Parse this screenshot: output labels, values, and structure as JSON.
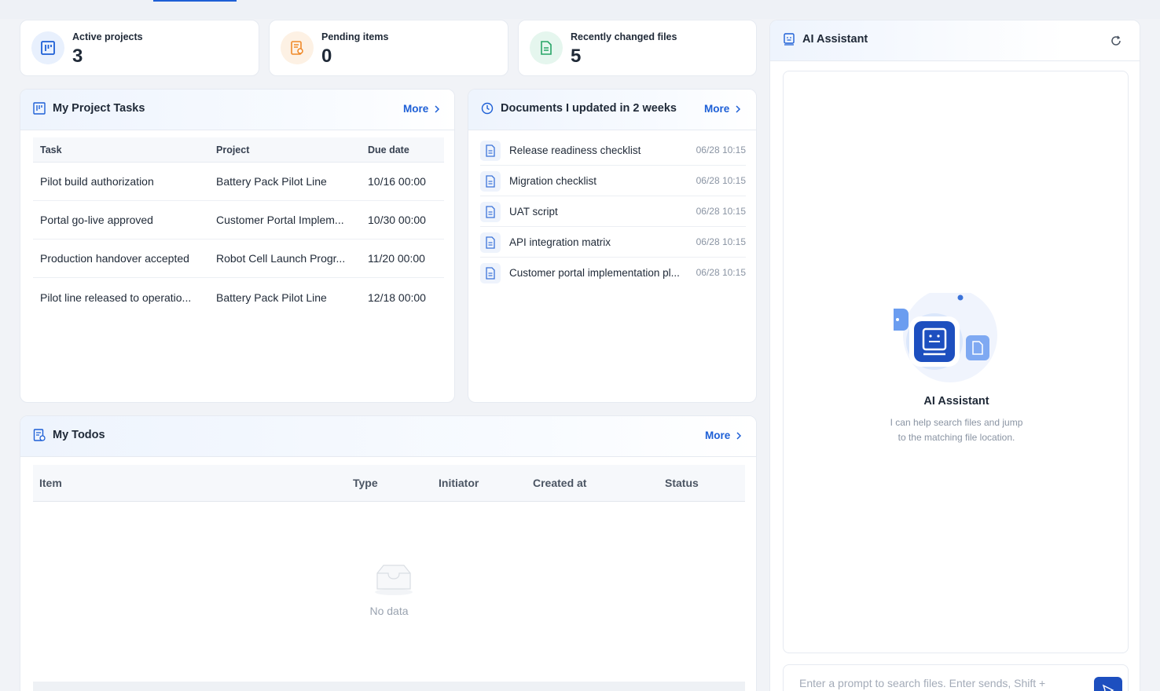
{
  "stats": [
    {
      "label": "Active projects",
      "value": "3",
      "icon": "kanban-icon",
      "bg": "#e8f0fd",
      "color": "#1d5fd6"
    },
    {
      "label": "Pending items",
      "value": "0",
      "icon": "pending-doc-icon",
      "bg": "#fdf1e4",
      "color": "#f08a2a"
    },
    {
      "label": "Recently changed files",
      "value": "5",
      "icon": "file-icon",
      "bg": "#e5f6ee",
      "color": "#27a567"
    }
  ],
  "tasks": {
    "title": "My Project Tasks",
    "more": "More",
    "columns": [
      "Task",
      "Project",
      "Due date"
    ],
    "rows": [
      [
        "Pilot build authorization",
        "Battery Pack Pilot Line",
        "10/16 00:00"
      ],
      [
        "Portal go-live approved",
        "Customer Portal Implem...",
        "10/30 00:00"
      ],
      [
        "Production handover accepted",
        "Robot Cell Launch Progr...",
        "11/20 00:00"
      ],
      [
        "Pilot line released to operatio...",
        "Battery Pack Pilot Line",
        "12/18 00:00"
      ]
    ]
  },
  "docs": {
    "title": "Documents I updated in 2 weeks",
    "more": "More",
    "items": [
      {
        "name": "Release readiness checklist",
        "time": "06/28 10:15"
      },
      {
        "name": "Migration checklist",
        "time": "06/28 10:15"
      },
      {
        "name": "UAT script",
        "time": "06/28 10:15"
      },
      {
        "name": "API integration matrix",
        "time": "06/28 10:15"
      },
      {
        "name": "Customer portal implementation pl...",
        "time": "06/28 10:15"
      }
    ]
  },
  "todos": {
    "title": "My Todos",
    "more": "More",
    "columns": [
      "Item",
      "Type",
      "Initiator",
      "Created at",
      "Status"
    ],
    "empty": "No data"
  },
  "assistant": {
    "title": "AI Assistant",
    "welcome_title": "AI Assistant",
    "welcome_line1": "I can help search files and jump",
    "welcome_line2": "to the matching file location.",
    "placeholder": "Enter a prompt to search files. Enter sends, Shift +"
  }
}
